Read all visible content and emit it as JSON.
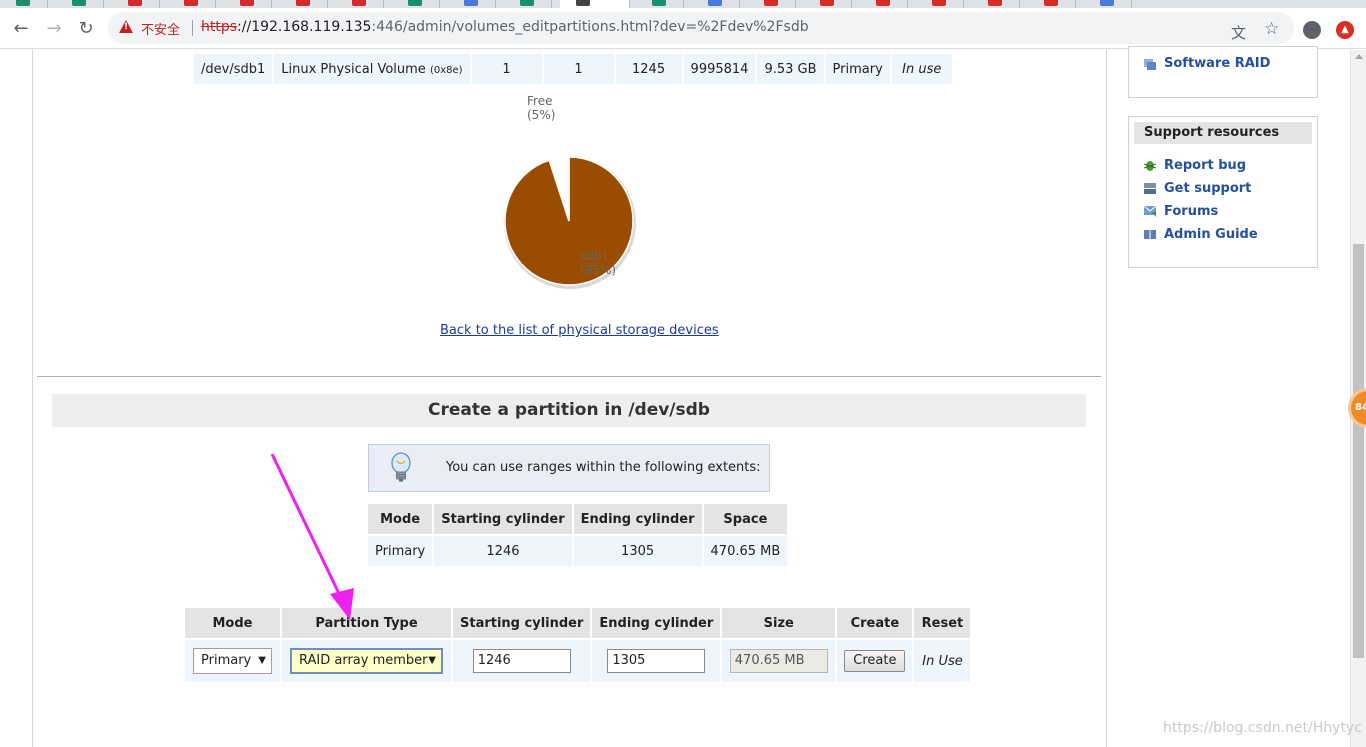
{
  "browser": {
    "security_label": "不安全",
    "url_scheme": "https",
    "url_host": "://192.168.119.135",
    "url_rest": ":446/admin/volumes_editpartitions.html?dev=%2Fdev%2Fsdb"
  },
  "partitions": {
    "rows": [
      {
        "device": "/dev/sdb1",
        "type": "Linux Physical Volume",
        "type_code": "(0x8e)",
        "start_col1": "1",
        "start_col2": "1",
        "end_cylinder": "1245",
        "blocks": "9995814",
        "size": "9.53 GB",
        "mode": "Primary",
        "status": "In use"
      }
    ]
  },
  "chart_data": {
    "type": "pie",
    "slices": [
      {
        "label": "sdb1",
        "percent": 95,
        "display": "(95%)",
        "color": "#9a4c00"
      },
      {
        "label": "Free",
        "percent": 5,
        "display": "(5%)",
        "color": "#ffffff"
      }
    ]
  },
  "back_link": "Back to the list of physical storage devices",
  "create": {
    "title": "Create a partition in /dev/sdb",
    "hint": "You can use ranges within the following extents:",
    "extents": {
      "headers": [
        "Mode",
        "Starting cylinder",
        "Ending cylinder",
        "Space"
      ],
      "row": {
        "mode": "Primary",
        "start": "1246",
        "end": "1305",
        "space": "470.65 MB"
      }
    },
    "form": {
      "headers": [
        "Mode",
        "Partition Type",
        "Starting cylinder",
        "Ending cylinder",
        "Size",
        "Create",
        "Reset"
      ],
      "mode_value": "Primary",
      "partition_type_value": "RAID array member",
      "start_value": "1246",
      "end_value": "1305",
      "size_value": "470.65 MB",
      "create_button": "Create",
      "reset_text": "In Use"
    }
  },
  "sidebar": {
    "top_link": "Software RAID",
    "support_title": "Support resources",
    "support_links": [
      "Report bug",
      "Get support",
      "Forums",
      "Admin Guide"
    ]
  },
  "badge": "84",
  "watermark": "https://blog.csdn.net/Hhytyc",
  "colors": {
    "accent_link": "#2450a0",
    "annotation_arrow": "#ee22ee",
    "pie_used": "#9a4c00"
  }
}
